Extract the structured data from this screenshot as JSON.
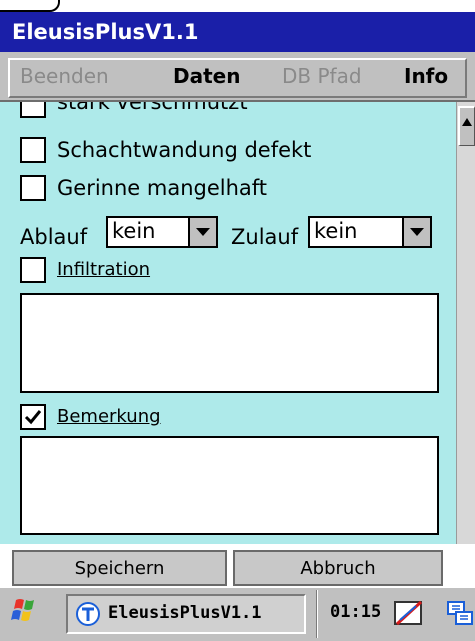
{
  "window": {
    "title": "EleusisPlusV1.1"
  },
  "menu": [
    {
      "label": "Beenden",
      "enabled": false
    },
    {
      "label": "Daten",
      "enabled": true
    },
    {
      "label": "DB Pfad",
      "enabled": false
    },
    {
      "label": "Info",
      "enabled": true
    }
  ],
  "form": {
    "checkboxes": [
      {
        "label": "stark verschmutzt",
        "checked": false
      },
      {
        "label": "Schachtwandung defekt",
        "checked": false
      },
      {
        "label": "Gerinne mangelhaft",
        "checked": false
      }
    ],
    "ablauf": {
      "label": "Ablauf",
      "value": "kein"
    },
    "zulauf": {
      "label": "Zulauf",
      "value": "kein"
    },
    "infiltration": {
      "label": "Infiltration",
      "checked": false,
      "text": ""
    },
    "bemerkung": {
      "label": "Bemerkung",
      "checked": true,
      "text": ""
    }
  },
  "buttons": {
    "save": "Speichern",
    "cancel": "Abbruch"
  },
  "taskbar": {
    "task_label": "EleusisPlusV1.1",
    "clock": "01:15"
  },
  "icons": [
    "windows-start-icon",
    "app-icon",
    "keyboard-tray-icon",
    "network-tray-icon",
    "chevron-down-icon",
    "scroll-up-arrow-icon",
    "checkmark-icon"
  ],
  "colors": {
    "titlebar": "#1a1fa8",
    "content_bg": "#aeeaea",
    "menubar": "#c0c0c0"
  }
}
